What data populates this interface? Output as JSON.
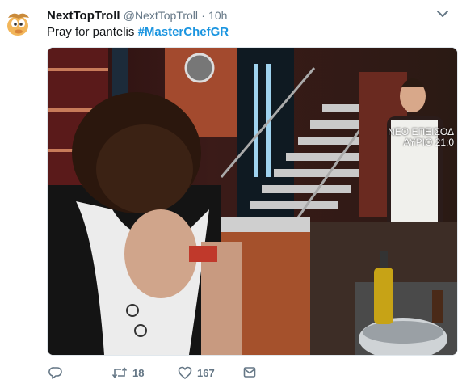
{
  "tweet": {
    "display_name": "NextTopTroll",
    "handle": "@NextTopTroll",
    "separator": "·",
    "time": "10h",
    "text_plain": "Pray for pantelis",
    "hashtag": "#MasterChefGR",
    "media_overlay_text_1": "ΝΕΟ ΕΠΕΙΣΟΔ",
    "media_overlay_text_2": "ΑΥΡΙΟ 21:0"
  },
  "actions": {
    "retweets": "18",
    "likes": "167"
  },
  "colors": {
    "link": "#1b95e0",
    "muted": "#657786"
  },
  "icons": [
    "avatar-cartoon",
    "chevron-down-icon",
    "reply-icon",
    "retweet-icon",
    "like-icon",
    "share-icon"
  ]
}
